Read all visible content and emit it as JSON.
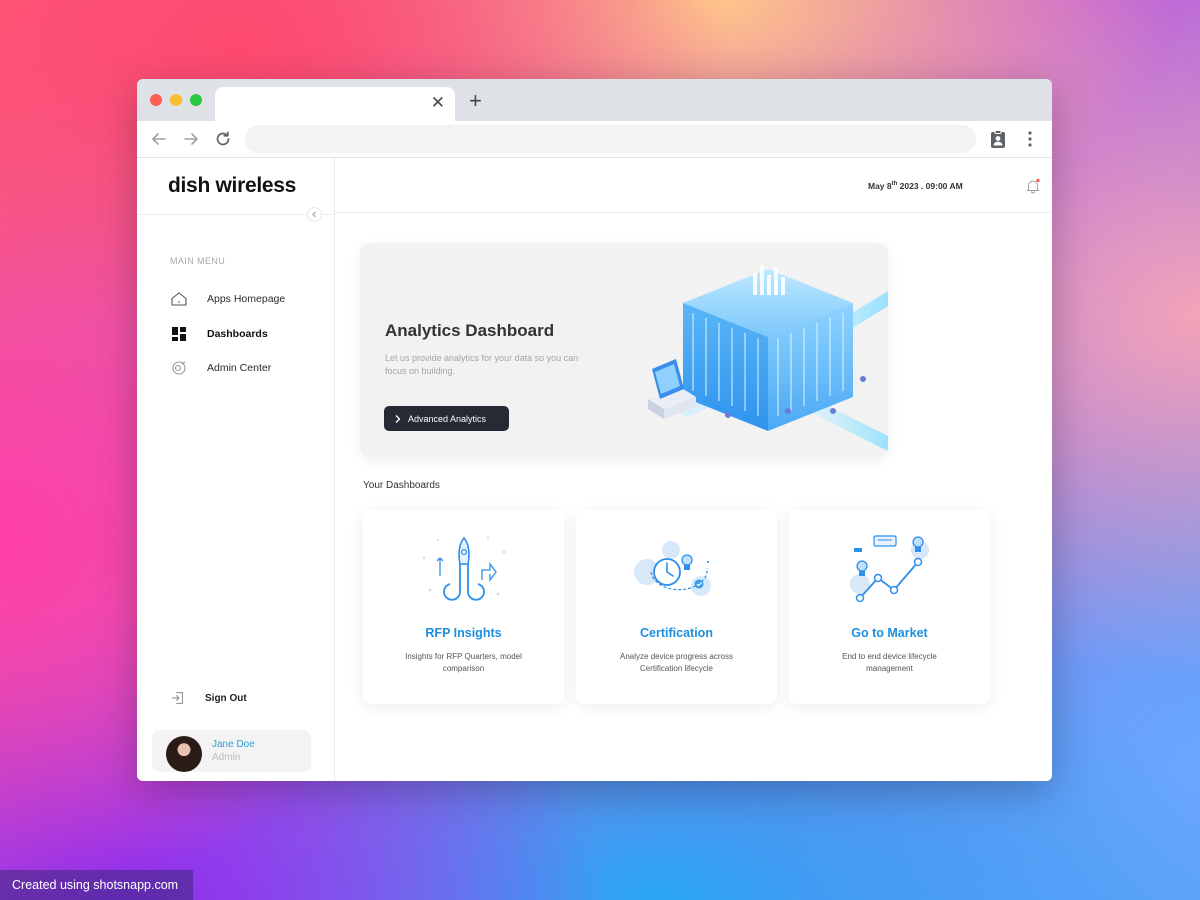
{
  "browser": {
    "tab_close_icon": "close-icon",
    "new_tab_icon": "plus-icon"
  },
  "sidebar": {
    "logo": "dish wireless",
    "menu_title": "MAIN MENU",
    "items": [
      {
        "label": "Apps Homepage",
        "icon": "home-icon"
      },
      {
        "label": "Dashboards",
        "icon": "grid-icon"
      },
      {
        "label": "Admin Center",
        "icon": "admin-icon"
      }
    ],
    "sign_out": "Sign Out",
    "user": {
      "name": "Jane Doe",
      "role": "Admin"
    }
  },
  "topbar": {
    "date_prefix": "May 8",
    "date_suffix": "th",
    "date_rest": " 2023 . 09:00 AM"
  },
  "hero": {
    "title": "Analytics Dashboard",
    "subtitle": "Let us provide analytics for your data so you can focus on building.",
    "button": "Advanced Analytics"
  },
  "dashboards": {
    "title": "Your Dashboards",
    "cards": [
      {
        "title": "RFP Insights",
        "desc": "Insights for RFP Quarters, model comparison"
      },
      {
        "title": "Certification",
        "desc": "Analyze device progress across Certification lifecycle"
      },
      {
        "title": "Go to Market",
        "desc": "End to end device lifecycle management"
      }
    ]
  },
  "colors": {
    "accent": "#1d8fe0",
    "button_dark": "#252a34",
    "user_name": "#2a9fd8"
  },
  "watermark": "Created using shotsnapp.com"
}
